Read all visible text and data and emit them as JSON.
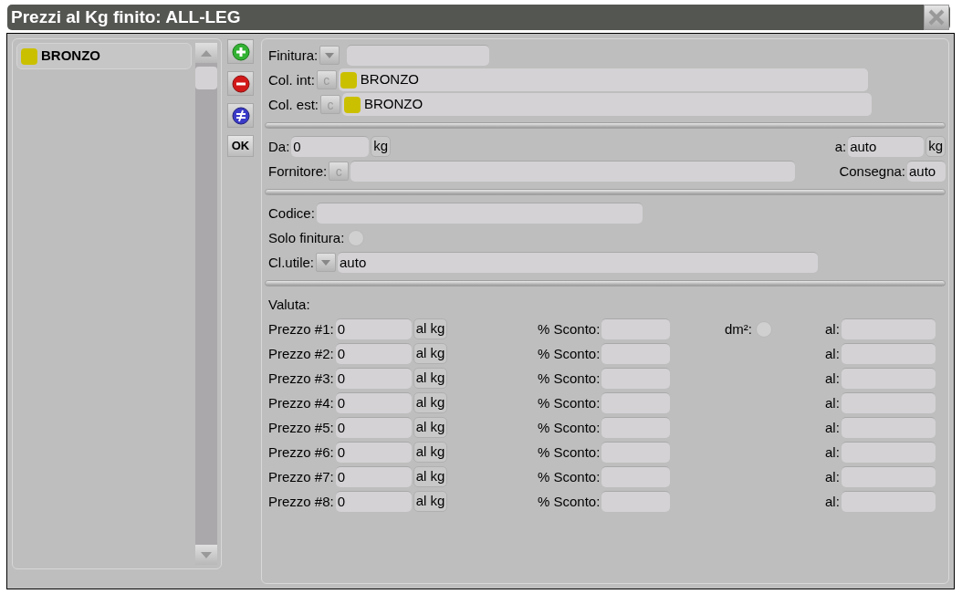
{
  "window": {
    "title": "Prezzi al Kg finito: ALL-LEG"
  },
  "list": {
    "items": [
      {
        "label": "BRONZO",
        "color": "#cbc000",
        "selected": true
      }
    ]
  },
  "toolbar": {
    "ok_label": "OK"
  },
  "form": {
    "finitura": {
      "label": "Finitura:"
    },
    "col_int": {
      "label": "Col. int:",
      "button": "c",
      "color": "#cbc000",
      "value": "BRONZO"
    },
    "col_est": {
      "label": "Col. est:",
      "button": "c",
      "color": "#cbc000",
      "value": "BRONZO"
    },
    "da": {
      "label": "Da:",
      "value": "0",
      "unit": "kg"
    },
    "a": {
      "label": "a:",
      "value": "auto",
      "unit": "kg"
    },
    "fornitore": {
      "label": "Fornitore:",
      "button": "c"
    },
    "consegna": {
      "label": "Consegna:",
      "value": "auto"
    },
    "codice": {
      "label": "Codice:"
    },
    "solo_finitura": {
      "label": "Solo finitura:",
      "checked": false
    },
    "cl_utile": {
      "label": "Cl.utile:",
      "value": "auto"
    },
    "valuta": {
      "label": "Valuta:"
    },
    "dm2": {
      "label": "dm²:",
      "checked": false
    },
    "prices": [
      {
        "label": "Prezzo #1:",
        "value": "0",
        "unit": "al kg",
        "discount_label": "% Sconto:",
        "al_label": "al:"
      },
      {
        "label": "Prezzo #2:",
        "value": "0",
        "unit": "al kg",
        "discount_label": "% Sconto:",
        "al_label": "al:"
      },
      {
        "label": "Prezzo #3:",
        "value": "0",
        "unit": "al kg",
        "discount_label": "% Sconto:",
        "al_label": "al:"
      },
      {
        "label": "Prezzo #4:",
        "value": "0",
        "unit": "al kg",
        "discount_label": "% Sconto:",
        "al_label": "al:"
      },
      {
        "label": "Prezzo #5:",
        "value": "0",
        "unit": "al kg",
        "discount_label": "% Sconto:",
        "al_label": "al:"
      },
      {
        "label": "Prezzo #6:",
        "value": "0",
        "unit": "al kg",
        "discount_label": "% Sconto:",
        "al_label": "al:"
      },
      {
        "label": "Prezzo #7:",
        "value": "0",
        "unit": "al kg",
        "discount_label": "% Sconto:",
        "al_label": "al:"
      },
      {
        "label": "Prezzo #8:",
        "value": "0",
        "unit": "al kg",
        "discount_label": "% Sconto:",
        "al_label": "al:"
      }
    ]
  }
}
